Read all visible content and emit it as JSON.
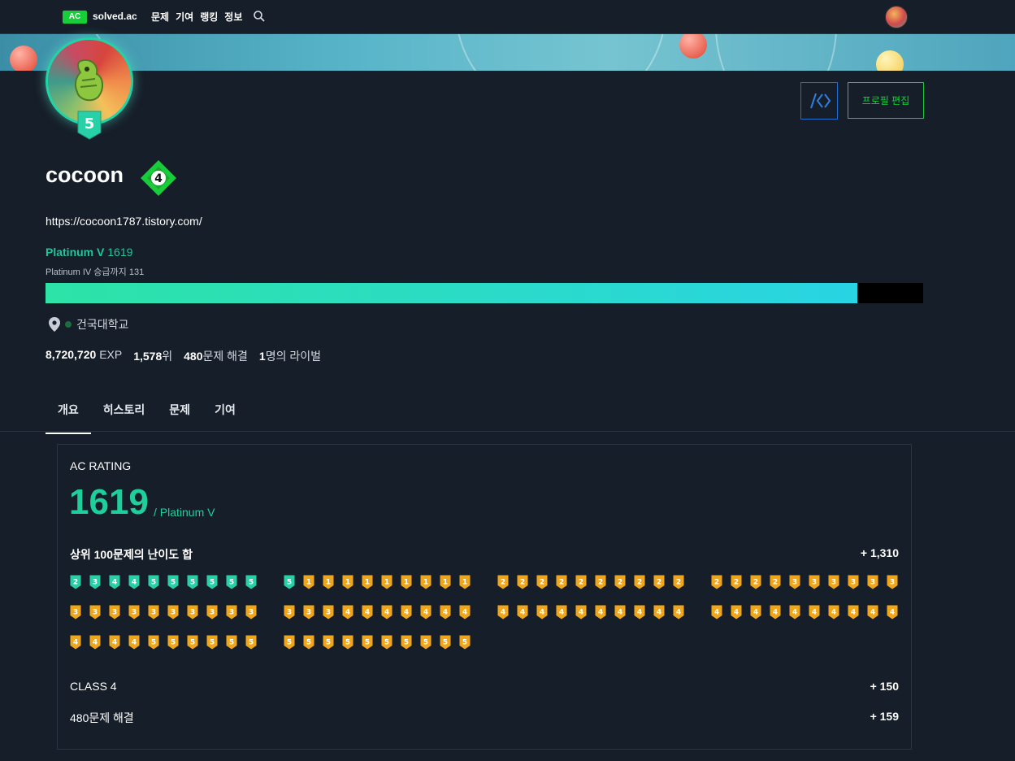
{
  "nav": {
    "logo_badge": "AC",
    "logo_text": "solved.ac",
    "links": [
      "문제",
      "기여",
      "랭킹",
      "정보"
    ]
  },
  "profile": {
    "username": "cocoon",
    "class": "4",
    "tier_shield": "5",
    "blog": "https://cocoon1787.tistory.com/",
    "tier_name": "Platinum V",
    "rating": "1619",
    "promotion": "Platinum IV 승급까지 131",
    "progress": 0.925,
    "organization": "건국대학교",
    "exp_value": "8,720,720",
    "exp_unit": "EXP",
    "rank_value": "1,578",
    "rank_unit": "위",
    "solved_value": "480",
    "solved_unit": "문제 해결",
    "rival_value": "1",
    "rival_unit": "명의 라이벌",
    "edit_button": "프로필 편집"
  },
  "tabs": [
    "개요",
    "히스토리",
    "문제",
    "기여"
  ],
  "rating_card": {
    "title": "AC RATING",
    "rating": "1619",
    "tier": "/ Platinum V",
    "top100_label": "상위 100문제의 난이도 합",
    "top100_value": "+ 1,310",
    "class_label": "CLASS 4",
    "class_value": "+ 150",
    "solved_label": "480문제 해결",
    "solved_value": "+ 159"
  },
  "levels": [
    "p2",
    "p3",
    "p4",
    "p4",
    "p5",
    "p5",
    "p5",
    "p5",
    "p5",
    "p5",
    "p5",
    "g1",
    "g1",
    "g1",
    "g1",
    "g1",
    "g1",
    "g1",
    "g1",
    "g1",
    "g2",
    "g2",
    "g2",
    "g2",
    "g2",
    "g2",
    "g2",
    "g2",
    "g2",
    "g2",
    "g2",
    "g2",
    "g2",
    "g2",
    "g3",
    "g3",
    "g3",
    "g3",
    "g3",
    "g3",
    "g3",
    "g3",
    "g3",
    "g3",
    "g3",
    "g3",
    "g3",
    "g3",
    "g3",
    "g3",
    "g3",
    "g3",
    "g3",
    "g4",
    "g4",
    "g4",
    "g4",
    "g4",
    "g4",
    "g4",
    "g4",
    "g4",
    "g4",
    "g4",
    "g4",
    "g4",
    "g4",
    "g4",
    "g4",
    "g4",
    "g4",
    "g4",
    "g4",
    "g4",
    "g4",
    "g4",
    "g4",
    "g4",
    "g4",
    "g4",
    "g4",
    "g4",
    "g4",
    "g4",
    "g5",
    "g5",
    "g5",
    "g5",
    "g5",
    "g5",
    "g5",
    "g5",
    "g5",
    "g5",
    "g5",
    "g5",
    "g5",
    "g5",
    "g5",
    "g5"
  ],
  "colors": {
    "accent_green": "#17ce3a",
    "platinum": "#1fcf9b",
    "gold": "#f0a61a",
    "platinum_badge": "#27d0a7"
  }
}
